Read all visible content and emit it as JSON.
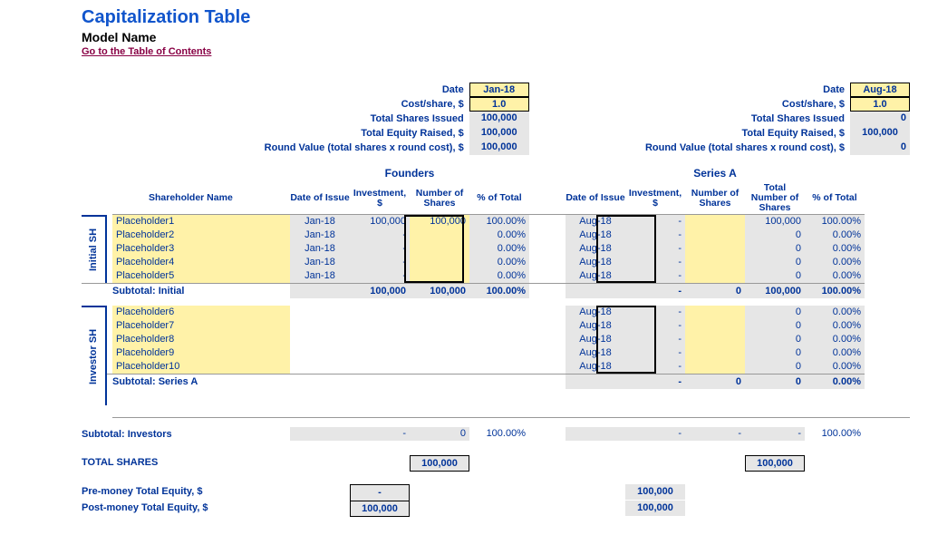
{
  "header": {
    "title": "Capitalization Table",
    "subtitle": "Model Name",
    "toc": "Go to the Table of Contents"
  },
  "labels": {
    "date": "Date",
    "cost_share": "Cost/share, $",
    "total_shares_issued": "Total Shares Issued",
    "total_equity_raised": "Total Equity Raised, $",
    "round_value": "Round Value (total shares x round cost), $",
    "shareholder_name": "Shareholder Name",
    "date_of_issue": "Date of Issue",
    "investment": "Investment, $",
    "num_shares": "Number of Shares",
    "pct_total": "% of Total",
    "total_num_shares": "Total Number of Shares",
    "founders": "Founders",
    "series_a": "Series A",
    "initial_sh": "Initial SH",
    "investor_sh": "Investor SH",
    "subtotal_initial": "Subtotal: Initial",
    "subtotal_series_a": "Subtotal: Series A",
    "subtotal_investors": "Subtotal: Investors",
    "total_shares": "TOTAL SHARES",
    "pre_money": "Pre-money Total Equity, $",
    "post_money": "Post-money Total Equity, $"
  },
  "founders_summary": {
    "date": "Jan-18",
    "cost_share": "1.0",
    "total_shares_issued": "100,000",
    "total_equity_raised": "100,000",
    "round_value": "100,000"
  },
  "seriesa_summary": {
    "date": "Aug-18",
    "cost_share": "1.0",
    "total_shares_issued": "0",
    "total_equity_raised": "100,000",
    "round_value": "0"
  },
  "initial": [
    {
      "name": "Placeholder1",
      "f_date": "Jan-18",
      "f_inv": "100,000",
      "f_sh": "100,000",
      "f_pct": "100.00%",
      "a_date": "Aug-18",
      "a_inv": "-",
      "a_sh": "",
      "a_tot": "100,000",
      "a_pct": "100.00%"
    },
    {
      "name": "Placeholder2",
      "f_date": "Jan-18",
      "f_inv": "-",
      "f_sh": "",
      "f_pct": "0.00%",
      "a_date": "Aug-18",
      "a_inv": "-",
      "a_sh": "",
      "a_tot": "0",
      "a_pct": "0.00%"
    },
    {
      "name": "Placeholder3",
      "f_date": "Jan-18",
      "f_inv": "-",
      "f_sh": "",
      "f_pct": "0.00%",
      "a_date": "Aug-18",
      "a_inv": "-",
      "a_sh": "",
      "a_tot": "0",
      "a_pct": "0.00%"
    },
    {
      "name": "Placeholder4",
      "f_date": "Jan-18",
      "f_inv": "-",
      "f_sh": "",
      "f_pct": "0.00%",
      "a_date": "Aug-18",
      "a_inv": "-",
      "a_sh": "",
      "a_tot": "0",
      "a_pct": "0.00%"
    },
    {
      "name": "Placeholder5",
      "f_date": "Jan-18",
      "f_inv": "-",
      "f_sh": "",
      "f_pct": "0.00%",
      "a_date": "Aug-18",
      "a_inv": "-",
      "a_sh": "",
      "a_tot": "0",
      "a_pct": "0.00%"
    }
  ],
  "initial_subtotal": {
    "f_inv": "100,000",
    "f_sh": "100,000",
    "f_pct": "100.00%",
    "a_inv": "-",
    "a_sh": "0",
    "a_tot": "100,000",
    "a_pct": "100.00%"
  },
  "investors": [
    {
      "name": "Placeholder6",
      "a_date": "Aug-18",
      "a_inv": "-",
      "a_sh": "",
      "a_tot": "0",
      "a_pct": "0.00%"
    },
    {
      "name": "Placeholder7",
      "a_date": "Aug-18",
      "a_inv": "-",
      "a_sh": "",
      "a_tot": "0",
      "a_pct": "0.00%"
    },
    {
      "name": "Placeholder8",
      "a_date": "Aug-18",
      "a_inv": "-",
      "a_sh": "",
      "a_tot": "0",
      "a_pct": "0.00%"
    },
    {
      "name": "Placeholder9",
      "a_date": "Aug-18",
      "a_inv": "-",
      "a_sh": "",
      "a_tot": "0",
      "a_pct": "0.00%"
    },
    {
      "name": "Placeholder10",
      "a_date": "Aug-18",
      "a_inv": "-",
      "a_sh": "",
      "a_tot": "0",
      "a_pct": "0.00%"
    }
  ],
  "seriesa_subtotal": {
    "a_inv": "-",
    "a_sh": "0",
    "a_tot": "0",
    "a_pct": "0.00%"
  },
  "investors_subtotal": {
    "f_inv": "-",
    "f_sh": "0",
    "f_pct": "100.00%",
    "a_inv": "-",
    "a_sh": "-",
    "a_tot": "-",
    "a_pct": "100.00%"
  },
  "totals": {
    "f_shares": "100,000",
    "a_shares": "100,000",
    "f_pre": "-",
    "f_post": "100,000",
    "a_pre": "100,000",
    "a_post": "100,000"
  }
}
